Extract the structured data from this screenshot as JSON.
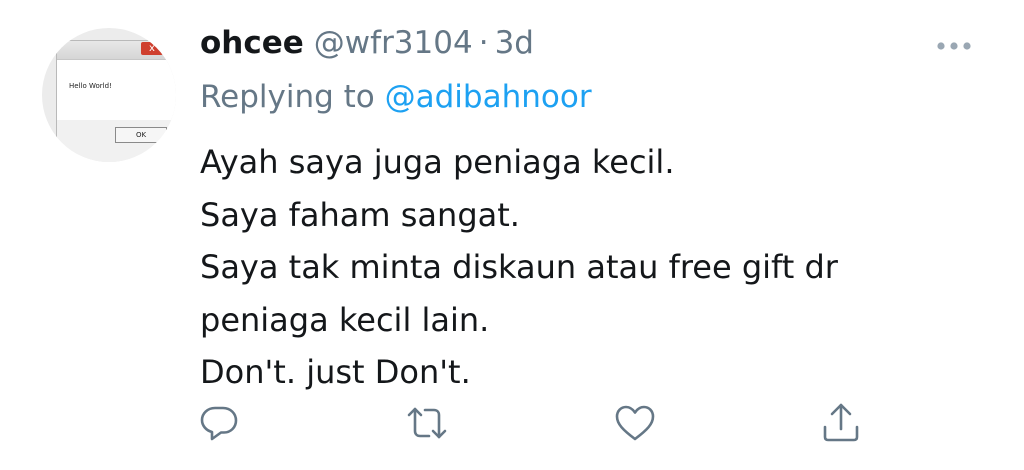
{
  "tweet": {
    "display_name": "ohcee",
    "handle": "@wfr3104",
    "separator": "·",
    "time": "3d",
    "replying_prefix": "Replying to ",
    "replying_to": "@adibahnoor",
    "text_lines": [
      "Ayah saya juga peniaga kecil.",
      "Saya faham sangat.",
      "Saya tak minta diskaun atau free gift dr",
      "peniaga kecil lain.",
      "Don't. just Don't."
    ],
    "avatar": {
      "dialog_text": "Hello World!",
      "ok_label": "OK",
      "close_label": "x"
    }
  },
  "icons": {
    "more": "more-horizontal-icon",
    "reply": "reply-icon",
    "retweet": "retweet-icon",
    "like": "like-icon",
    "share": "share-icon"
  },
  "colors": {
    "text": "#14171a",
    "secondary": "#657786",
    "link": "#1da1f2",
    "icon": "#657786"
  }
}
